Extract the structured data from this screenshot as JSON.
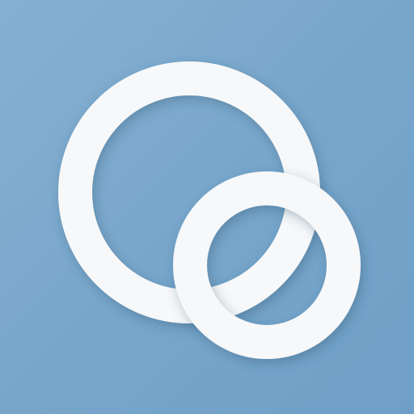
{
  "app_icon": {
    "icon_name": "overlapping-circles-icon",
    "colors": {
      "background_light": "#86b0d2",
      "background_mid": "#78a6cb",
      "background_dark": "#6f9fc7",
      "ring": "#f7f8f9",
      "shadow": "#2d4d67"
    }
  }
}
